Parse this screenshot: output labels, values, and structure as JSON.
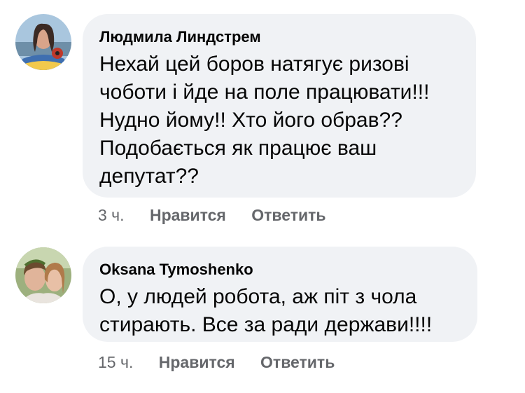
{
  "comments": [
    {
      "author": "Людмила Линдстрем",
      "text_lines": [
        "Нехай цей боров натягує ризові",
        "чоботи і йде на поле працювати!!!",
        "Нудно йому!! Хто його обрав??",
        "Подобається як працює ваш",
        "депутат??"
      ],
      "time": "3 ч.",
      "like_label": "Нравится",
      "reply_label": "Ответить",
      "avatar_icon": "user-avatar-icon"
    },
    {
      "author": "Oksana Tymoshenko",
      "text_lines": [
        "О, у людей робота, аж піт з чола",
        "стирають. Все за ради держави!!!!"
      ],
      "time": "15 ч.",
      "like_label": "Нравится",
      "reply_label": "Ответить",
      "avatar_icon": "user-avatar-icon"
    }
  ],
  "colors": {
    "bubble": "#f0f2f5",
    "text": "#050505",
    "meta": "#65676b"
  }
}
